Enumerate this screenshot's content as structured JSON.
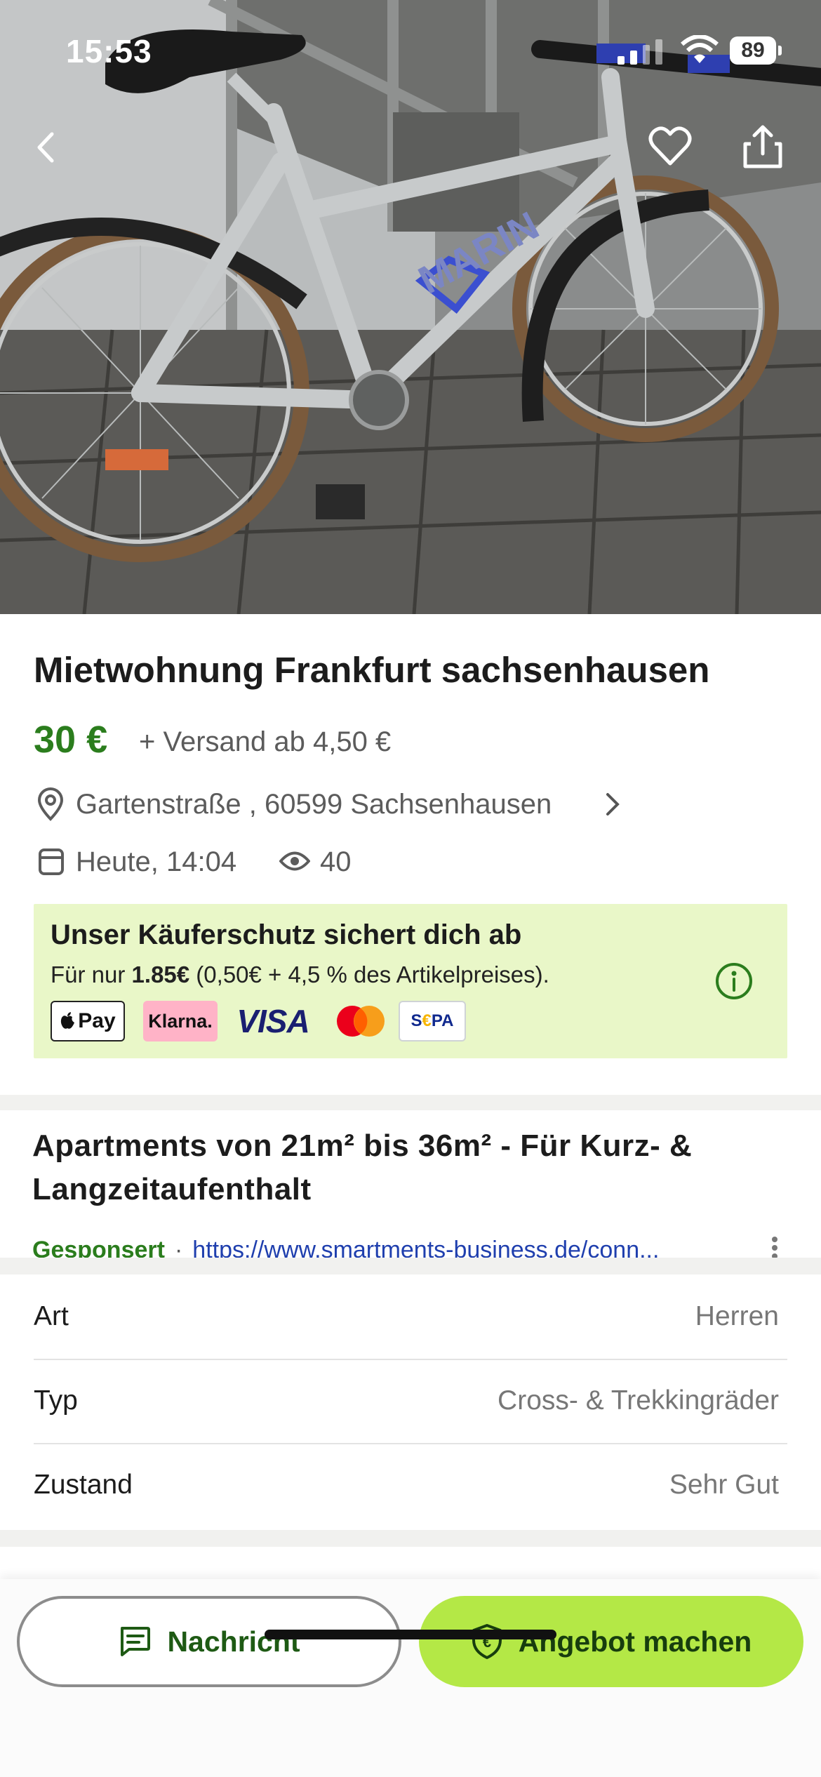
{
  "status_bar": {
    "time": "15:53",
    "battery": "89"
  },
  "listing": {
    "title": "Mietwohnung Frankfurt  sachsenhausen",
    "price": "30 €",
    "shipping": "+ Versand ab 4,50 €",
    "address": "Gartenstraße , 60599 Sachsenhausen",
    "date": "Heute, 14:04",
    "views": "40"
  },
  "buyer_protection": {
    "title": "Unser Käuferschutz sichert dich ab",
    "text_prefix": "Für nur ",
    "fee": "1.85€",
    "text_suffix": " (0,50€ + 4,5 % des Artikelpreises).",
    "payment_methods": [
      "Pay",
      "Klarna.",
      "VISA",
      "Mastercard",
      "SEPA"
    ]
  },
  "ad": {
    "title": "Apartments von 21m² bis 36m² - Für Kurz- & Langzeitaufenthalt",
    "sponsored_label": "Gesponsert",
    "separator": "·",
    "url": "https://www.smartments-business.de/conn..."
  },
  "attributes": [
    {
      "key": "Art",
      "value": "Herren"
    },
    {
      "key": "Typ",
      "value": "Cross- & Trekkingräder"
    },
    {
      "key": "Zustand",
      "value": "Sehr Gut"
    }
  ],
  "actions": {
    "message_label": "Nachricht",
    "offer_label": "Angebot machen"
  },
  "colors": {
    "price_green": "#2b7d1d",
    "offer_button": "#b4e846",
    "protection_bg": "#e9f7c8"
  }
}
